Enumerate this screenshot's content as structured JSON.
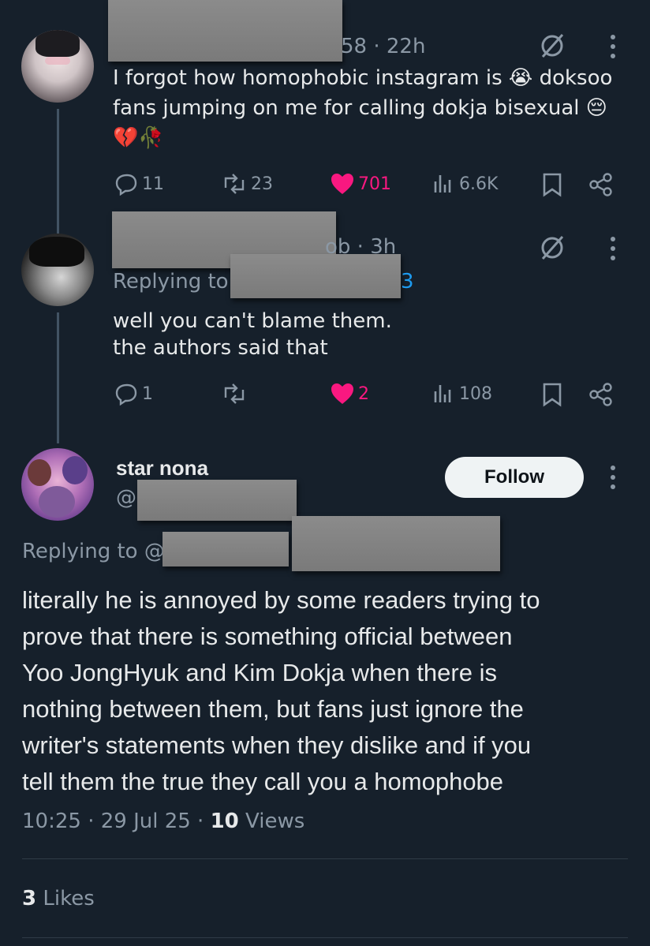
{
  "reply1": {
    "meta_suffix": "58 · 22h",
    "text_line1": "I forgot how homophobic instagram is 😭 doksoo",
    "text_line2": "fans jumping on me for calling dokja bisexual 😔",
    "text_line3": "💔🥀",
    "stats": {
      "replies": "11",
      "reposts": "23",
      "likes": "701",
      "views": "6.6K"
    }
  },
  "reply2": {
    "meta_suffix": "ob · 3h",
    "replying_to_label": "Replying to",
    "replying_to_suffix": "3",
    "text_line1": "well you can't blame them.",
    "text_line2": "the authors said that",
    "stats": {
      "replies": "1",
      "reposts": "",
      "likes": "2",
      "views": "108"
    }
  },
  "main": {
    "display_name": "star nona",
    "handle_prefix": "@",
    "follow_label": "Follow",
    "replying_to_label": "Replying to @",
    "body_lines": [
      "literally he is annoyed by some readers trying to",
      "prove that there is something official between",
      "Yoo JongHyuk and Kim Dokja when there is",
      "nothing between them, but fans just ignore the",
      "writer's statements when they dislike and if you",
      "tell them the true they call you a homophobe"
    ],
    "timestamp": "10:25 · 29 Jul 25 · ",
    "views_count": "10",
    "views_label": " Views",
    "likes_count": "3",
    "likes_label": " Likes"
  },
  "colors": {
    "background": "#16202b",
    "text": "#e7e9ea",
    "muted": "#8b98a5",
    "like": "#f91880",
    "link": "#1d9bf0"
  }
}
